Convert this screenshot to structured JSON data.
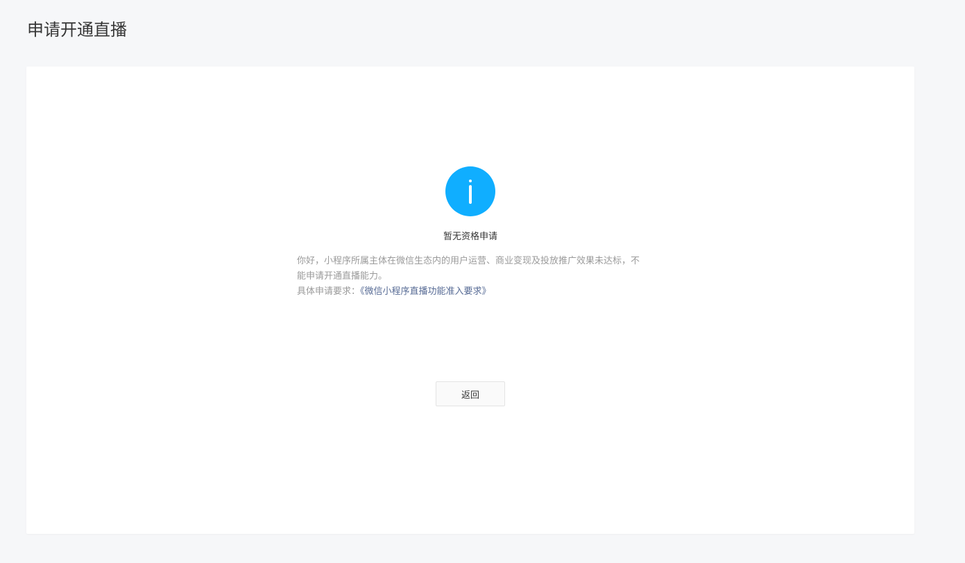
{
  "page": {
    "title": "申请开通直播"
  },
  "message": {
    "icon": "info-icon",
    "icon_color": "#10aeff",
    "title": "暂无资格申请",
    "description": "你好，小程序所属主体在微信生态内的用户运营、商业变现及投放推广效果未达标，不能申请开通直播能力。",
    "requirement_label": "具体申请要求：",
    "requirement_link": "《微信小程序直播功能准入要求》",
    "link_color": "#576b95"
  },
  "actions": {
    "back_label": "返回"
  }
}
